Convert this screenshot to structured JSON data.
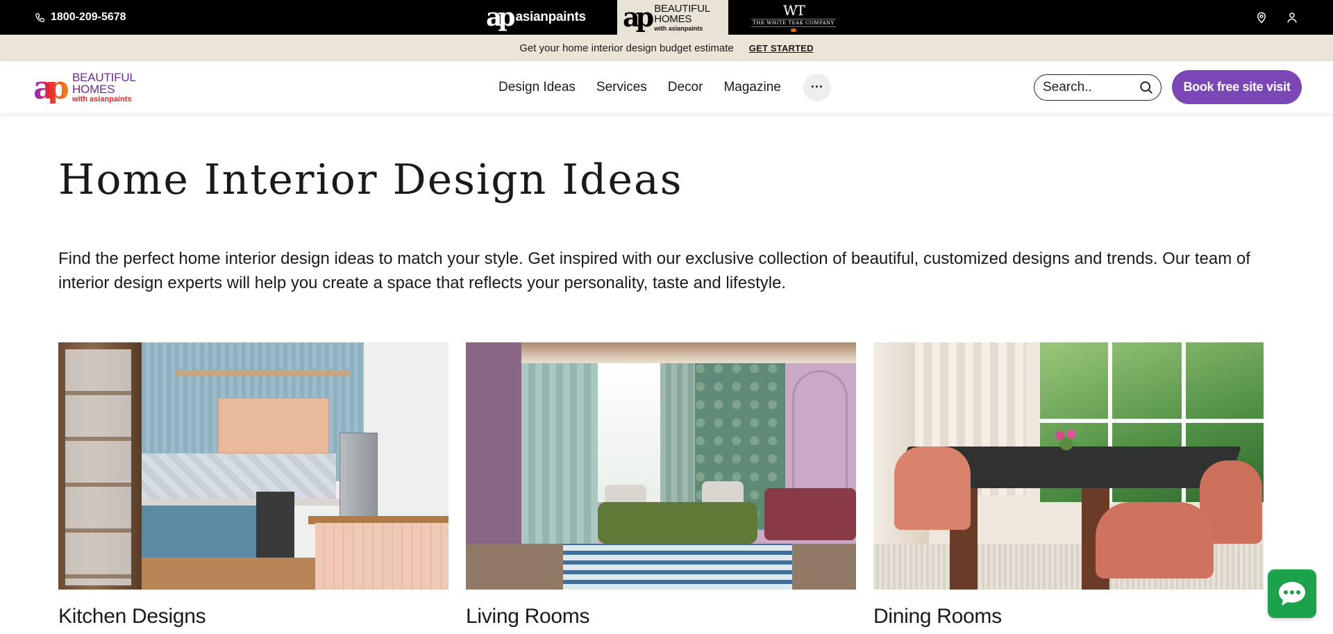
{
  "topbar": {
    "phone": "1800-209-5678",
    "brands": {
      "asianpaints": "asianpaints",
      "beautiful_homes": {
        "line1": "BEAUTIFUL",
        "line2": "HOMES",
        "line3": "with asianpaints"
      },
      "white_teak": {
        "mark": "WT",
        "name": "THE WHITE TEAK COMPANY"
      }
    },
    "icons": [
      "phone-icon",
      "location-pin-icon",
      "user-icon"
    ]
  },
  "promo": {
    "text": "Get your home interior design budget estimate",
    "cta": "GET STARTED"
  },
  "nav": {
    "logo": {
      "line1": "BEAUTIFUL",
      "line2": "HOMES",
      "line3": "with asianpaints"
    },
    "links": [
      "Design Ideas",
      "Services",
      "Decor",
      "Magazine"
    ],
    "more": "···",
    "search_placeholder": "Search..",
    "book_button": "Book free site visit"
  },
  "main": {
    "title": "Home Interior Design Ideas",
    "intro": "Find the perfect home interior design ideas to match your style. Get inspired with our exclusive collection of beautiful, customized designs and trends. Our team of interior design experts will help you create a space that reflects your personality, taste and lifestyle.",
    "cards": [
      {
        "title": "Kitchen Designs"
      },
      {
        "title": "Living Rooms"
      },
      {
        "title": "Dining Rooms"
      }
    ]
  },
  "colors": {
    "accent_purple": "#7b47b6",
    "chat_green": "#1ba24a",
    "promo_bg": "#ebe5d8",
    "topbar_bg": "#000000"
  }
}
